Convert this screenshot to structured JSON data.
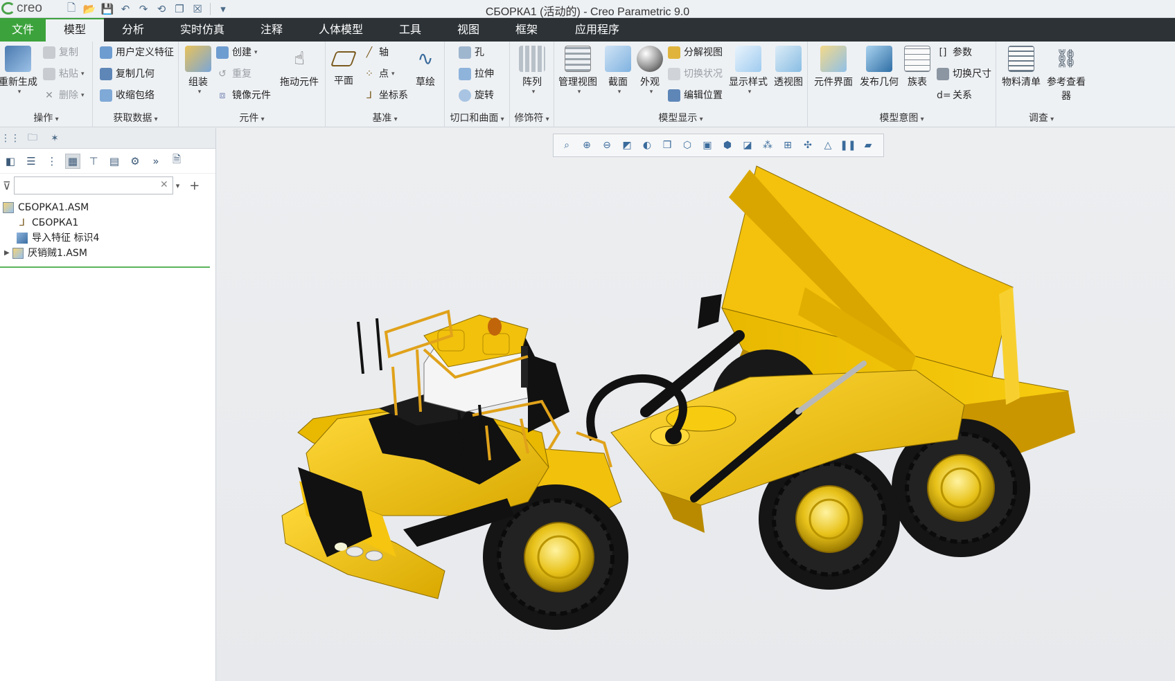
{
  "app": {
    "logo_text": "creo",
    "window_title": "СБОРКА1 (活动的) - Creo Parametric 9.0"
  },
  "quick_access": [
    "new-icon",
    "open-icon",
    "save-icon",
    "undo-icon",
    "redo-icon",
    "regenerate-icon",
    "windows-icon",
    "close-icon",
    "customize-icon"
  ],
  "menu_tabs": [
    "文件",
    "模型",
    "分析",
    "实时仿真",
    "注释",
    "人体模型",
    "工具",
    "视图",
    "框架",
    "应用程序"
  ],
  "ribbon": {
    "operations": {
      "label": "操作",
      "regenerate": "重新生成",
      "copy": "复制",
      "paste": "粘贴",
      "delete": "删除"
    },
    "get_data": {
      "label": "获取数据",
      "udf": "用户定义特征",
      "copy_geom": "复制几何",
      "shrinkwrap": "收缩包络"
    },
    "component": {
      "label": "元件",
      "assemble": "组装",
      "create": "创建",
      "repeat": "重复",
      "mirror": "镜像元件",
      "drag": "拖动元件"
    },
    "datum": {
      "label": "基准",
      "plane": "平面",
      "axis": "轴",
      "point": "点",
      "csys": "坐标系",
      "sketch": "草绘"
    },
    "cut_surface": {
      "label": "切口和曲面",
      "hole": "孔",
      "extrude": "拉伸",
      "revolve": "旋转"
    },
    "modifiers": {
      "label": "修饰符",
      "pattern": "阵列"
    },
    "model_display": {
      "label": "模型显示",
      "manage_views": "管理视图",
      "section": "截面",
      "appearance": "外观",
      "exploded": "分解视图",
      "toggle_status": "切换状况",
      "edit_position": "编辑位置",
      "display_style": "显示样式",
      "perspective": "透视图"
    },
    "model_intent": {
      "label": "模型意图",
      "component_interface": "元件界面",
      "publish_geom": "发布几何",
      "family_table": "族表",
      "parameters": "参数",
      "switch_dims": "切换尺寸",
      "relations": "关系"
    },
    "investigate": {
      "label": "调查",
      "bom": "物料清单",
      "reference_viewer": "参考查看",
      "reference_viewer_2": "器"
    }
  },
  "model_tree": {
    "search_value": "",
    "items": [
      {
        "label": "СБОРКА1.ASM",
        "icon": "assembly-icon"
      },
      {
        "label": "СБОРКА1",
        "icon": "csys-icon"
      },
      {
        "label": "导入特征 标识4",
        "icon": "import-feature-icon"
      },
      {
        "label": "厌销贼1.ASM",
        "icon": "assembly-icon"
      }
    ]
  },
  "colors": {
    "accent_green": "#3ca33c",
    "tab_bar": "#2c3236",
    "truck_yellow": "#f2c10c",
    "truck_black": "#141414"
  }
}
